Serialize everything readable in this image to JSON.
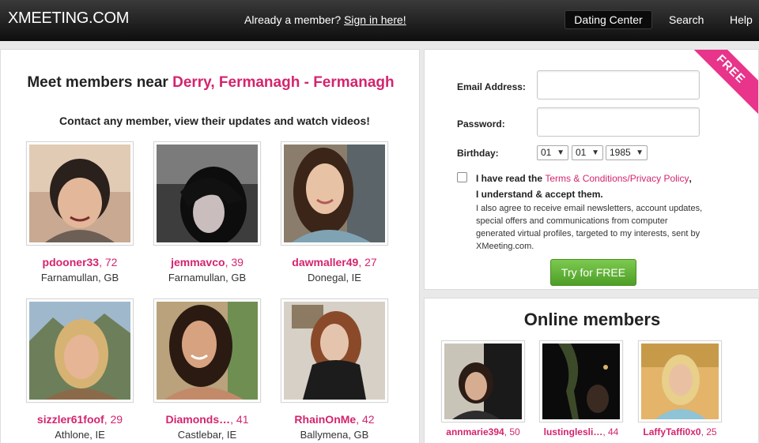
{
  "header": {
    "logo": "XMEETING.COM",
    "member_prompt": "Already a member?",
    "sign_in": "Sign in here!",
    "nav": [
      "Dating Center",
      "Search",
      "Help"
    ]
  },
  "left": {
    "heading_prefix": "Meet members near ",
    "location": "Derry, Fermanagh - Fermanagh",
    "subheading": "Contact any member, view their updates and watch videos!",
    "members": [
      {
        "name": "pdooner33",
        "age": ", 72",
        "location": "Farnamullan, GB"
      },
      {
        "name": "jemmavco",
        "age": ", 39",
        "location": "Farnamullan, GB"
      },
      {
        "name": "dawmaller49",
        "age": ", 27",
        "location": "Donegal, IE"
      },
      {
        "name": "sizzler61foof",
        "age": ", 29",
        "location": "Athlone, IE"
      },
      {
        "name": "Diamonds…",
        "age": ", 41",
        "location": "Castlebar, IE"
      },
      {
        "name": "RhainOnMe",
        "age": ", 42",
        "location": "Ballymena, GB"
      }
    ]
  },
  "signup": {
    "ribbon": "FREE",
    "email_label": "Email Address:",
    "email_value": "",
    "password_label": "Password:",
    "password_value": "",
    "birthday_label": "Birthday:",
    "day": "01",
    "month": "01",
    "year": "1985",
    "terms_prefix": "I have read the ",
    "terms_link": "Terms & Conditions",
    "terms_sep": "/",
    "privacy_link": "Privacy Policy",
    "terms_suffix": ",",
    "terms_line2": "I understand & accept them.",
    "agree_text": "I also agree to receive email newsletters, account updates, special offers and communications from computer generated virtual profiles, targeted to my interests, sent by XMeeting.com.",
    "button": "Try for FREE"
  },
  "online": {
    "title": "Online members",
    "members": [
      {
        "name": "annmarie394",
        "age": ", 50"
      },
      {
        "name": "lustinglesli…",
        "age": ", 44"
      },
      {
        "name": "LaffyTaffi0x0",
        "age": ", 25"
      }
    ]
  },
  "colors": {
    "accent": "#d4246e",
    "ribbon": "#e8348a",
    "button": "#5fae36",
    "header": "#111111"
  }
}
